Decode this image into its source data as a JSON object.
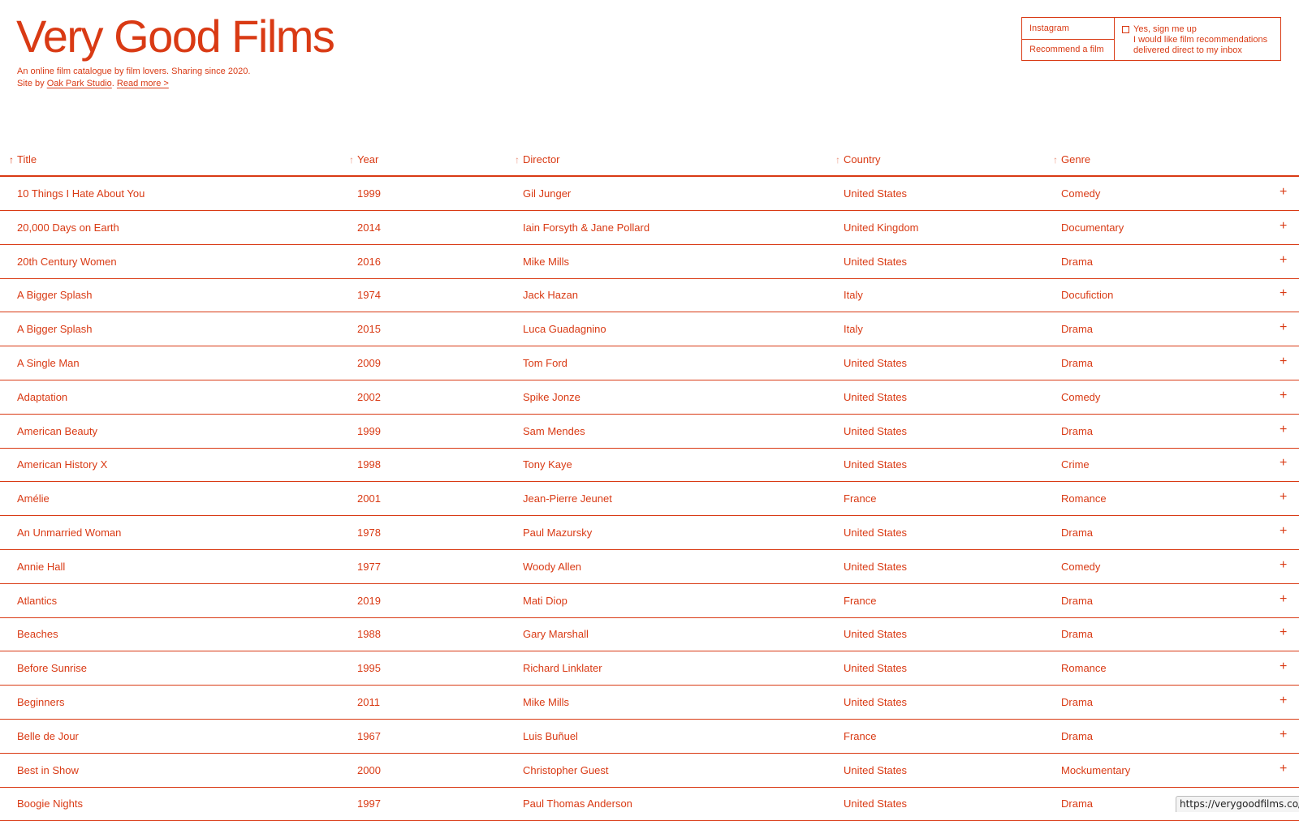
{
  "site": {
    "title": "Very Good Films",
    "tagline": "An online film catalogue by film lovers. Sharing since 2020.",
    "credit_prefix": "Site by ",
    "credit_link": "Oak Park Studio",
    "credit_sep": ".",
    "read_more": "Read more >"
  },
  "box": {
    "instagram": "Instagram",
    "recommend": "Recommend a film",
    "signup_title": "Yes, sign me up",
    "signup_line1": "I would like film recommendations",
    "signup_line2": "delivered direct to my inbox",
    "signup_checked": false
  },
  "table": {
    "headers": [
      "Title",
      "Year",
      "Director",
      "Country",
      "Genre"
    ],
    "sorted_by": "Title",
    "sort_arrow": "↑",
    "expand_glyph": "+",
    "rows": [
      [
        "10 Things I Hate About You",
        "1999",
        "Gil Junger",
        "United States",
        "Comedy"
      ],
      [
        "20,000 Days on Earth",
        "2014",
        "Iain Forsyth & Jane Pollard",
        "United Kingdom",
        "Documentary"
      ],
      [
        "20th Century Women",
        "2016",
        "Mike Mills",
        "United States",
        "Drama"
      ],
      [
        "A Bigger Splash",
        "1974",
        "Jack Hazan",
        "Italy",
        "Docufiction"
      ],
      [
        "A Bigger Splash",
        "2015",
        "Luca Guadagnino",
        "Italy",
        "Drama"
      ],
      [
        "A Single Man",
        "2009",
        "Tom Ford",
        "United States",
        "Drama"
      ],
      [
        "Adaptation",
        "2002",
        "Spike Jonze",
        "United States",
        "Comedy"
      ],
      [
        "American Beauty",
        "1999",
        "Sam Mendes",
        "United States",
        "Drama"
      ],
      [
        "American History X",
        "1998",
        "Tony Kaye",
        "United States",
        "Crime"
      ],
      [
        "Amélie",
        "2001",
        "Jean-Pierre Jeunet",
        "France",
        "Romance"
      ],
      [
        "An Unmarried Woman",
        "1978",
        "Paul Mazursky",
        "United States",
        "Drama"
      ],
      [
        "Annie Hall",
        "1977",
        "Woody Allen",
        "United States",
        "Comedy"
      ],
      [
        "Atlantics",
        "2019",
        "Mati Diop",
        "France",
        "Drama"
      ],
      [
        "Beaches",
        "1988",
        "Gary Marshall",
        "United States",
        "Drama"
      ],
      [
        "Before Sunrise",
        "1995",
        "Richard Linklater",
        "United States",
        "Romance"
      ],
      [
        "Beginners",
        "2011",
        "Mike Mills",
        "United States",
        "Drama"
      ],
      [
        "Belle de Jour",
        "1967",
        "Luis Buñuel",
        "France",
        "Drama"
      ],
      [
        "Best in Show",
        "2000",
        "Christopher Guest",
        "United States",
        "Mockumentary"
      ],
      [
        "Boogie Nights",
        "1997",
        "Paul Thomas Anderson",
        "United States",
        "Drama"
      ]
    ]
  },
  "status_bar": {
    "url": "https://verygoodfilms.co/#"
  },
  "colors": {
    "accent": "#d93a14",
    "background": "#ffffff"
  }
}
